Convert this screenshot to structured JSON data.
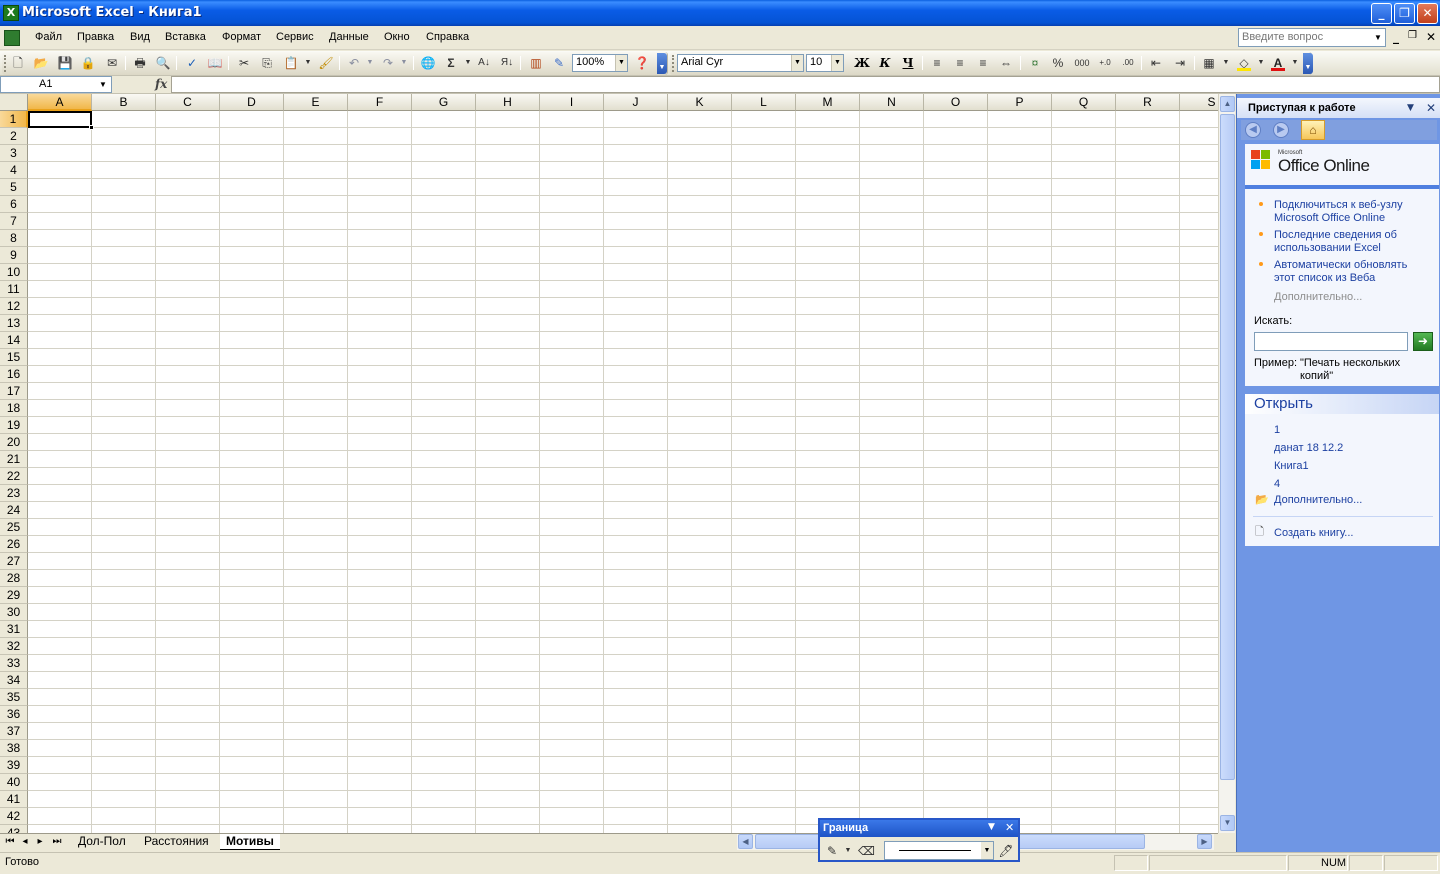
{
  "window": {
    "title": "Microsoft Excel - Книга1",
    "app_icon": "excel-icon"
  },
  "menu": {
    "items": [
      {
        "label": "Файл"
      },
      {
        "label": "Правка"
      },
      {
        "label": "Вид"
      },
      {
        "label": "Вставка"
      },
      {
        "label": "Формат"
      },
      {
        "label": "Сервис"
      },
      {
        "label": "Данные"
      },
      {
        "label": "Окно"
      },
      {
        "label": "Справка"
      }
    ],
    "ask_placeholder": "Введите вопрос"
  },
  "toolbar": {
    "zoom": "100%",
    "font_name": "Arial Cyr",
    "font_size": "10",
    "bold": "Ж",
    "italic": "К",
    "underline": "Ч",
    "sum_symbol": "Σ",
    "percent": "%",
    "thousands": "000",
    "font_color_letter": "А",
    "font_color": "#e01010",
    "fill_color": "#ffe600"
  },
  "formula_bar": {
    "name_box": "A1",
    "fx": "fx",
    "content": ""
  },
  "sheet": {
    "columns": [
      "A",
      "B",
      "C",
      "D",
      "E",
      "F",
      "G",
      "H",
      "I",
      "J",
      "K",
      "L",
      "M",
      "N",
      "O",
      "P",
      "Q",
      "R",
      "S"
    ],
    "rows": [
      "1",
      "2",
      "3",
      "4",
      "5",
      "6",
      "7",
      "8",
      "9",
      "10",
      "11",
      "12",
      "13",
      "14",
      "15",
      "16",
      "17",
      "18",
      "19",
      "20",
      "21",
      "22",
      "23",
      "24",
      "25",
      "26",
      "27",
      "28",
      "29",
      "30",
      "31",
      "32",
      "33",
      "34",
      "35",
      "36",
      "37",
      "38",
      "39",
      "40",
      "41",
      "42",
      "43"
    ],
    "active_cell": "A1"
  },
  "tabs": [
    {
      "label": "Дол-Пол",
      "active": false
    },
    {
      "label": "Расстояния",
      "active": false
    },
    {
      "label": "Мотивы",
      "active": true
    }
  ],
  "status": {
    "text": "Готово",
    "num": "NUM"
  },
  "task_pane": {
    "title": "Приступая к работе",
    "office_small": "Microsoft",
    "office_brand": "Office Online",
    "links": [
      "Подключиться к веб-узлу Microsoft Office Online",
      "Последние сведения об использовании Excel",
      "Автоматически обновлять этот список из Веба"
    ],
    "more_grey": "Дополнительно...",
    "search_label": "Искать:",
    "search_value": "",
    "example_label": "Пример:",
    "example_text": "\"Печать нескольких копий\"",
    "open_section": "Открыть",
    "recent_files": [
      "1",
      "данат 18 12.2",
      "Книга1",
      "4"
    ],
    "open_more": "Дополнительно...",
    "create_new": "Создать книгу..."
  },
  "border_toolbar": {
    "title": "Граница"
  }
}
